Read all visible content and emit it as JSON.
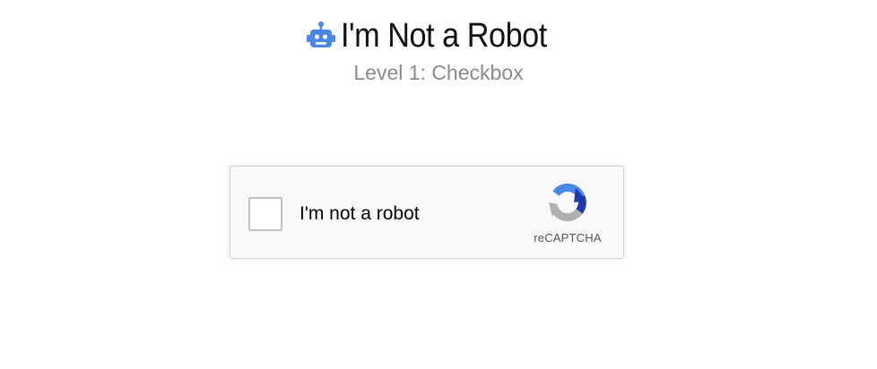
{
  "header": {
    "title": "I'm Not a Robot",
    "subtitle": "Level 1: Checkbox",
    "icon": "robot-icon"
  },
  "captcha": {
    "label": "I'm not a robot",
    "checked": false,
    "brand": "reCAPTCHA",
    "logo_icon": "recaptcha-logo-icon"
  },
  "colors": {
    "accent_blue": "#4a86e8",
    "dark_blue": "#1c3aa9",
    "logo_gray": "#b0b0b0"
  }
}
